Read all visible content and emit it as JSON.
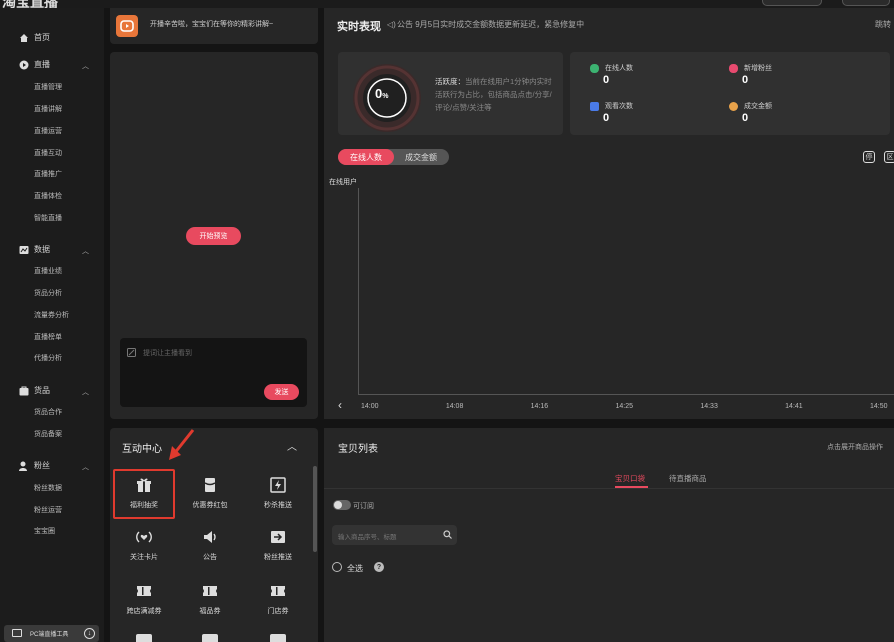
{
  "topbar": {
    "app_title": "淘宝直播"
  },
  "sidebar": {
    "home": "首页",
    "groups": [
      {
        "label": "直播",
        "icon": "play-icon",
        "items": [
          "直播管理",
          "直播讲解",
          "直播运营",
          "直播互动",
          "直播推广",
          "直播体检",
          "智能直播"
        ]
      },
      {
        "label": "数据",
        "icon": "chart-icon",
        "items": [
          "直播业绩",
          "货品分析",
          "流量券分析",
          "直播榜单",
          "代播分析"
        ]
      },
      {
        "label": "货品",
        "icon": "bag-icon",
        "items": [
          "货品合作",
          "货品备案"
        ]
      },
      {
        "label": "粉丝",
        "icon": "user-icon",
        "items": [
          "粉丝数据",
          "粉丝运营",
          "宝宝圈"
        ]
      }
    ],
    "pc_tool": "PC端直播工具"
  },
  "preview": {
    "message": "开播辛苦啦，宝宝们在等你的精彩讲解~",
    "start_button": "开始预览",
    "input_placeholder": "提词让主播看到",
    "send_button": "发送"
  },
  "realtime": {
    "title": "实时表现",
    "notice": "公告  9月5日实时成交金额数据更新延迟，紧急修复中",
    "edge_text": "跳转",
    "activity_value": "0",
    "activity_unit": "%",
    "activity_label": "活跃度：",
    "activity_desc": "当前在线用户1分钟内实时活跃行为占比，包括商品点击/分享/评论/点赞/关注等",
    "stats": [
      {
        "label": "在线人数",
        "value": "0",
        "color": "#3cb371"
      },
      {
        "label": "新增粉丝",
        "value": "0",
        "color": "#e84a6f"
      },
      {
        "label": "观看次数",
        "value": "0",
        "color": "#4a7be8"
      },
      {
        "label": "成交金额",
        "value": "0",
        "color": "#e8a24a"
      }
    ],
    "tabs": [
      "在线人数",
      "成交金额"
    ],
    "ctrl_icon_a": "停",
    "ctrl_icon_b": "区"
  },
  "chart_data": {
    "type": "line",
    "ylabel": "在线用户",
    "x": [
      "14:00",
      "14:08",
      "14:16",
      "14:25",
      "14:33",
      "14:41",
      "14:50"
    ],
    "series": [
      {
        "values": []
      }
    ]
  },
  "interaction": {
    "title": "互动中心",
    "tools": [
      {
        "label": "福利抽奖",
        "icon": "gift-icon"
      },
      {
        "label": "优惠券红包",
        "icon": "coupon-box-icon"
      },
      {
        "label": "秒杀推送",
        "icon": "flash-icon"
      },
      {
        "label": "关注卡片",
        "icon": "broadcast-heart-icon"
      },
      {
        "label": "公告",
        "icon": "speaker-icon"
      },
      {
        "label": "粉丝推送",
        "icon": "push-icon"
      },
      {
        "label": "跨店满减券",
        "icon": "ticket-icon"
      },
      {
        "label": "福品券",
        "icon": "ticket-icon"
      },
      {
        "label": "门店券",
        "icon": "ticket-icon"
      }
    ]
  },
  "products": {
    "title": "宝贝列表",
    "hint": "点击展开商品操作",
    "tabs": [
      "宝贝口袋",
      "待直播商品"
    ],
    "toggle_label": "可订阅",
    "search_placeholder": "输入商品序号、标题",
    "select_all": "全选",
    "help": "?"
  }
}
